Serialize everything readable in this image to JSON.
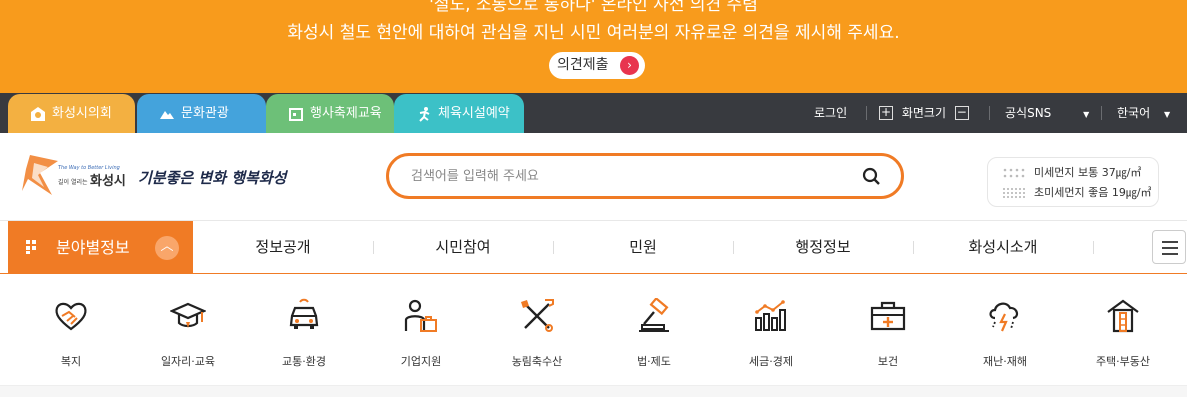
{
  "banner": {
    "line1": "'철도, 소통으로 통하다' 온라인 사전 의견 수렴",
    "line2": "화성시 철도 현안에 대하여 관심을 지닌 시민 여러분의 자유로운 의견을 제시해 주세요.",
    "button_label": "의견제출",
    "color": "#f89b1c"
  },
  "top_tabs": [
    {
      "label": "화성시의회",
      "icon": "council-icon",
      "color": "#f3b041"
    },
    {
      "label": "문화관광",
      "icon": "mountain-icon",
      "color": "#44a3dc"
    },
    {
      "label": "행사축제교육",
      "icon": "calendar-icon",
      "color": "#6dc078"
    },
    {
      "label": "체육시설예약",
      "icon": "runner-icon",
      "color": "#3cc1c7"
    }
  ],
  "utility": {
    "login": "로그인",
    "zoom_label": "화면크기",
    "zoom_in": "+",
    "zoom_out": "−",
    "sns": "공식SNS",
    "language": "한국어"
  },
  "header": {
    "logo_tagline": "The Way to Better Living",
    "logo_small": "길이 열리는",
    "logo_city": "화성시",
    "logo_slogan": "기분좋은 변화 행복화성",
    "search_placeholder": "검색어를 입력해 주세요",
    "dust": [
      {
        "label": "미세먼지 보통 37㎍/㎥"
      },
      {
        "label": "초미세먼지 좋음 19㎍/㎥"
      }
    ]
  },
  "nav": {
    "all_label": "분야별정보",
    "items": [
      "정보공개",
      "시민참여",
      "민원",
      "행정정보",
      "화성시소개"
    ]
  },
  "categories": [
    {
      "label": "복지",
      "icon": "handshake-heart-icon"
    },
    {
      "label": "일자리·교육",
      "icon": "graduation-cap-icon"
    },
    {
      "label": "교통·환경",
      "icon": "car-icon"
    },
    {
      "label": "기업지원",
      "icon": "businessman-icon"
    },
    {
      "label": "농림축수산",
      "icon": "farm-tools-icon"
    },
    {
      "label": "법·제도",
      "icon": "gavel-icon"
    },
    {
      "label": "세금·경제",
      "icon": "chart-growth-icon"
    },
    {
      "label": "보건",
      "icon": "medical-kit-icon"
    },
    {
      "label": "재난·재해",
      "icon": "storm-icon"
    },
    {
      "label": "주택·부동산",
      "icon": "house-icon"
    }
  ]
}
